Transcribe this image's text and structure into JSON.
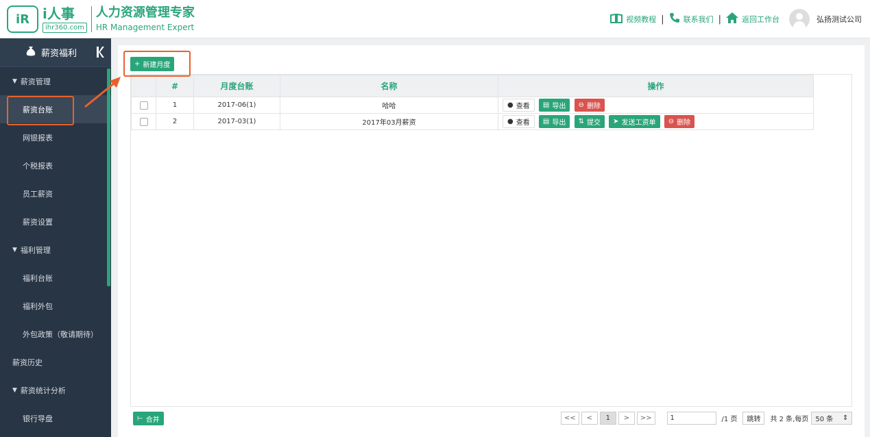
{
  "header": {
    "logo_badge": "iR",
    "logo_brand": "i人事",
    "logo_url": "ihr360.com",
    "logo_title": "人力资源管理专家",
    "logo_subtitle": "HR Management Expert",
    "links": [
      {
        "icon": "book-icon",
        "label": "视频教程"
      },
      {
        "icon": "phone-icon",
        "label": "联系我们"
      },
      {
        "icon": "home-icon",
        "label": "返回工作台"
      }
    ],
    "divider": "|",
    "company": "弘扬测试公司"
  },
  "sidebar": {
    "title": "薪资福利",
    "items": [
      {
        "label": "薪资管理",
        "type": "group"
      },
      {
        "label": "薪资台账",
        "type": "child",
        "active": true
      },
      {
        "label": "网银报表",
        "type": "child"
      },
      {
        "label": "个税报表",
        "type": "child"
      },
      {
        "label": "员工薪资",
        "type": "child"
      },
      {
        "label": "薪资设置",
        "type": "child"
      },
      {
        "label": "福利管理",
        "type": "group"
      },
      {
        "label": "福利台账",
        "type": "child"
      },
      {
        "label": "福利外包",
        "type": "child"
      },
      {
        "label": "外包政策（敬请期待）",
        "type": "child"
      },
      {
        "label": "薪资历史",
        "type": "top"
      },
      {
        "label": "薪资统计分析",
        "type": "group"
      },
      {
        "label": "银行导盘",
        "type": "child"
      }
    ]
  },
  "toolbar": {
    "new_month_label": "新建月度"
  },
  "table": {
    "headers": [
      "#",
      "月度台账",
      "名称",
      "操作"
    ],
    "rows": [
      {
        "num": "1",
        "month": "2017-06(1)",
        "name": "哈哈",
        "actions": [
          {
            "label": "查看",
            "style": "white",
            "icon": "info-icon"
          },
          {
            "label": "导出",
            "style": "green",
            "icon": "file-icon"
          },
          {
            "label": "删除",
            "style": "red",
            "icon": "minus-circle-icon"
          }
        ]
      },
      {
        "num": "2",
        "month": "2017-03(1)",
        "name": "2017年03月薪资",
        "actions": [
          {
            "label": "查看",
            "style": "white",
            "icon": "info-icon"
          },
          {
            "label": "导出",
            "style": "green",
            "icon": "file-icon"
          },
          {
            "label": "提交",
            "style": "green",
            "icon": "submit-icon"
          },
          {
            "label": "发送工资单",
            "style": "green",
            "icon": "send-icon"
          },
          {
            "label": "删除",
            "style": "red",
            "icon": "minus-circle-icon"
          }
        ]
      }
    ]
  },
  "footer": {
    "merge_label": "合并",
    "pager": {
      "first": "<<",
      "prev": "<",
      "current": "1",
      "next": ">",
      "last": ">>",
      "page_input": "1",
      "total_pages": "/1 页",
      "jump_label": "跳转",
      "summary": "共 2 条,每页",
      "per_page": "50 条"
    }
  },
  "colors": {
    "accent": "#2aa57a",
    "danger": "#d9534f",
    "sidebar_bg": "#283544",
    "highlight": "#e8612c"
  }
}
